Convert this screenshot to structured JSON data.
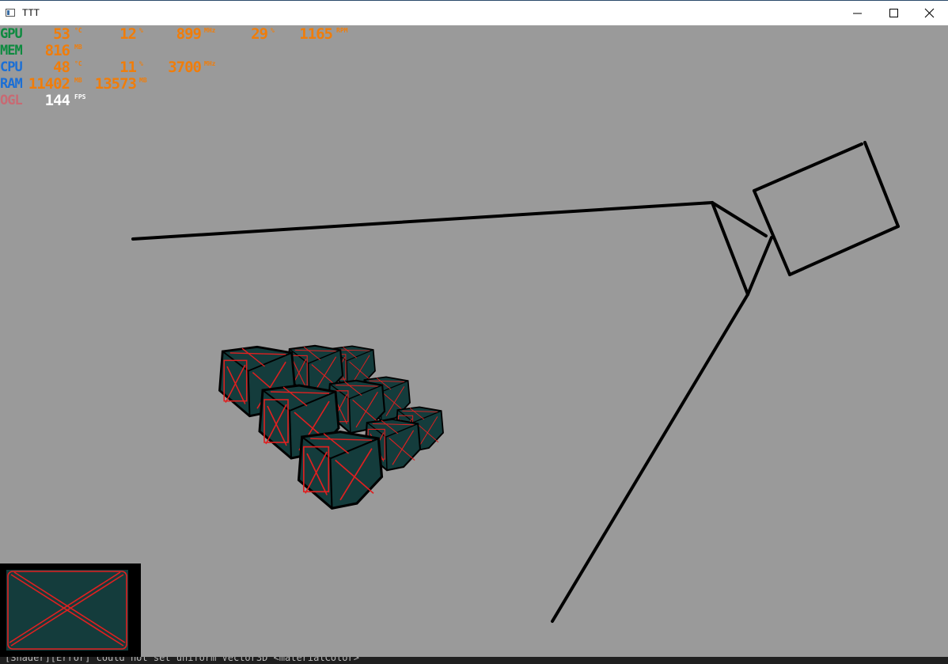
{
  "window": {
    "title": "TTT",
    "icon": "app-window-icon"
  },
  "controls": {
    "minimize_icon": "minimize-icon",
    "maximize_icon": "maximize-icon",
    "close_icon": "close-icon"
  },
  "hud": {
    "gpu": {
      "label": "GPU",
      "temp": "53",
      "temp_unit": "°C",
      "load": "12",
      "load_unit": "%",
      "clock": "899",
      "clock_unit": "MHz",
      "fan_pct": "29",
      "fan_pct_unit": "%",
      "fan_rpm": "1165",
      "fan_rpm_unit": "RPM"
    },
    "mem": {
      "label": "MEM",
      "used": "816",
      "used_unit": "MB"
    },
    "cpu": {
      "label": "CPU",
      "temp": "48",
      "temp_unit": "°C",
      "load": "11",
      "load_unit": "%",
      "clock": "3700",
      "clock_unit": "MHz"
    },
    "ram": {
      "label": "RAM",
      "used": "11402",
      "used_unit": "MB",
      "total": "13573",
      "total_unit": "MB"
    },
    "ogl": {
      "label": "OGL",
      "fps": "144",
      "fps_unit": "FPS"
    },
    "colors": {
      "gpu": "#0d8a3f",
      "cpu": "#1b6fd6",
      "ogl": "#c86a73",
      "value": "#f07d0a"
    }
  },
  "scene": {
    "background": "#9a9a9a",
    "cube_face": "#143c3c",
    "cube_line": "#e02020",
    "frustum_line": "#000000"
  },
  "console": {
    "text": "[Shader][Error] could not set uniform Vector3D <materialColor>"
  }
}
